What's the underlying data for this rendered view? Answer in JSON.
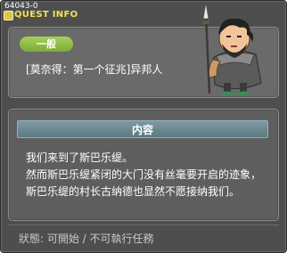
{
  "titlebar": {
    "quest_id": "64043-0",
    "title": "QUEST INFO"
  },
  "header": {
    "category": "一般",
    "quest_name": "[莫奈得：第一个征兆]异邦人"
  },
  "content": {
    "heading": "内容",
    "lines": [
      "我们来到了斯巴乐缇。",
      "然而斯巴乐缇紧闭的大门没有丝毫要开启的迹象，",
      "斯巴乐缇的村长古纳德也显然不愿接纳我们。"
    ]
  },
  "status": {
    "text": "狀態: 可開始 / 不可執行任務"
  },
  "colors": {
    "window_bg": "#4e4e4e",
    "title": "#f3e24f",
    "category_badge": "#8fbd45",
    "content_header": "#6d8a93"
  },
  "icons": {
    "title_icon": "quest-icon",
    "npc": "npc-warrior-portrait"
  }
}
